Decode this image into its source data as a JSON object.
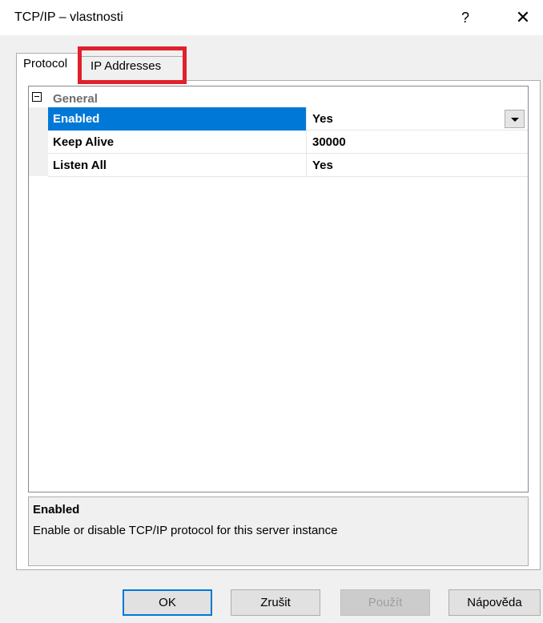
{
  "window": {
    "title": "TCP/IP – vlastnosti",
    "help_glyph": "?",
    "close_glyph": "✕"
  },
  "tabs": [
    {
      "label": "Protocol",
      "active": true
    },
    {
      "label": "IP Addresses",
      "active": false,
      "highlighted": true
    }
  ],
  "grid": {
    "category": {
      "label": "General",
      "expanded": true
    },
    "rows": [
      {
        "name": "Enabled",
        "value": "Yes",
        "selected": true,
        "has_dropdown": true
      },
      {
        "name": "Keep Alive",
        "value": "30000"
      },
      {
        "name": "Listen All",
        "value": "Yes"
      }
    ]
  },
  "description": {
    "title": "Enabled",
    "text": "Enable or disable TCP/IP protocol for this server instance"
  },
  "buttons": {
    "ok": "OK",
    "cancel": "Zrušit",
    "apply": "Použít",
    "help": "Nápověda"
  },
  "colors": {
    "selection": "#0078d7",
    "highlight_box": "#e0202a",
    "dialog_bg": "#f0f0f0"
  }
}
